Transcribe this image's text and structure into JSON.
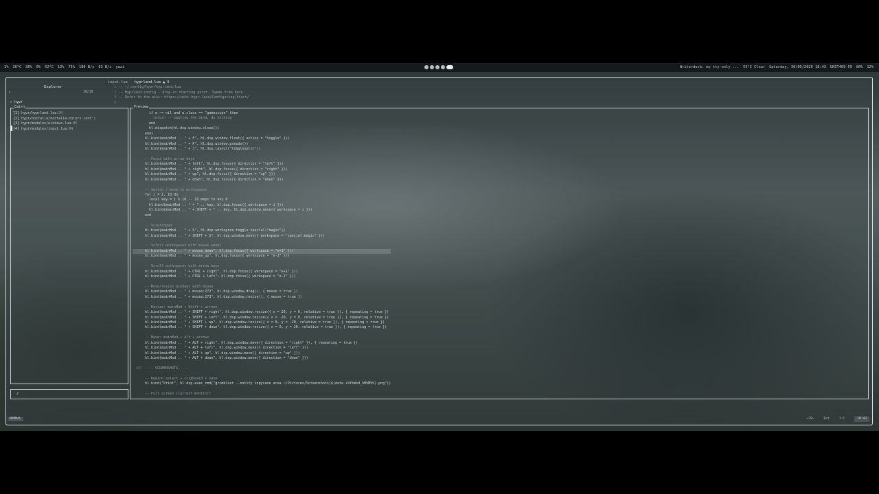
{
  "statusbar": {
    "left_items": [
      "1%",
      "36°C",
      "36%",
      "0%",
      "52°C",
      "12%",
      "75%",
      "100 B/s",
      "63 B/s",
      "yazi"
    ],
    "right_items": [
      "Writerdeck: my tty-only ...",
      "55°C Clear",
      "Saturday, 30/05/2026 18:43",
      "UNIT469-59",
      "80%",
      "12%"
    ]
  },
  "explorer": {
    "title": "Explorer",
    "count": "10/10",
    "cwd": "hypr",
    "group_label": "Cairn",
    "files": [
      {
        "index": "[1]",
        "path": "hypr/hyprland.lua",
        "suffix": ":34"
      },
      {
        "index": "[2]",
        "path": "hypr/noctalia/noctalia-colors.conf",
        "suffix": ":1"
      },
      {
        "index": "[3]",
        "path": "hypr/modules/windows.lua",
        "suffix": ":95"
      },
      {
        "index": "[4]",
        "path": "hypr/modules/input.lua",
        "suffix": ":84"
      }
    ],
    "prompt": "/"
  },
  "tabs": [
    {
      "label": "input.lua",
      "active": false
    },
    {
      "label": "hyprland.lua  ▲ 5",
      "active": true
    }
  ],
  "header_code": [
    {
      "n": "1",
      "t": "-- ~/.config/hypr/hyprland.lua"
    },
    {
      "n": "2",
      "t": "-- Hyprland config - drop-in starting point. Tweak from here."
    },
    {
      "n": "3",
      "t": "-- Refer to the wiki: https://wiki.hypr.land/Configuring/Start/"
    },
    {
      "n": "4",
      "t": ""
    }
  ],
  "preview": {
    "title": "Preview",
    "lines": [
      {
        "n": "",
        "t": "  if w ~= nil and w.class == \"gamescope\" then",
        "c": false
      },
      {
        "n": "",
        "t": "    return -- swallow the bind, do nothing",
        "c": true
      },
      {
        "n": "",
        "t": "  end",
        "c": false
      },
      {
        "n": "",
        "t": "  hl.dispatch(hl.dsp.window.close())",
        "c": false
      },
      {
        "n": "",
        "t": "end)",
        "c": false
      },
      {
        "n": "",
        "t": "hl.bind(mainMod .. \" + F\", hl.dsp.window.float({ action = \"toggle\" }))",
        "c": false
      },
      {
        "n": "",
        "t": "hl.bind(mainMod .. \" + P\", hl.dsp.window.pseudo())",
        "c": false
      },
      {
        "n": "",
        "t": "hl.bind(mainMod .. \" + J\", hl.dsp.layout(\"togglesplit\"))",
        "c": false
      },
      {
        "n": "",
        "t": "",
        "c": false
      },
      {
        "n": "",
        "t": "-- Focus with arrow keys",
        "c": true
      },
      {
        "n": "",
        "t": "hl.bind(mainMod .. \" + left\", hl.dsp.focus({ direction = \"left\" }))",
        "c": false
      },
      {
        "n": "",
        "t": "hl.bind(mainMod .. \" + right\", hl.dsp.focus({ direction = \"right\" }))",
        "c": false
      },
      {
        "n": "",
        "t": "hl.bind(mainMod .. \" + up\", hl.dsp.focus({ direction = \"up\" }))",
        "c": false
      },
      {
        "n": "",
        "t": "hl.bind(mainMod .. \" + down\", hl.dsp.focus({ direction = \"down\" }))",
        "c": false
      },
      {
        "n": "",
        "t": "",
        "c": false
      },
      {
        "n": "",
        "t": "-- Switch / move to workspaces",
        "c": true
      },
      {
        "n": "",
        "t": "for i = 1, 10 do",
        "c": false
      },
      {
        "n": "",
        "t": "  local key = i % 10 -- 10 maps to key 0",
        "c": false
      },
      {
        "n": "",
        "t": "  hl.bind(mainMod .. \" + \" .. key, hl.dsp.focus({ workspace = i }))",
        "c": false
      },
      {
        "n": "",
        "t": "  hl.bind(mainMod .. \" + SHIFT + \" .. key, hl.dsp.window.move({ workspace = i }))",
        "c": false
      },
      {
        "n": "",
        "t": "end",
        "c": false
      },
      {
        "n": "",
        "t": "",
        "c": false
      },
      {
        "n": "",
        "t": "-- Scratchpad",
        "c": true
      },
      {
        "n": "",
        "t": "hl.bind(mainMod .. \" + S\", hl.dsp.workspace.toggle_special(\"magic\"))",
        "c": false
      },
      {
        "n": "",
        "t": "hl.bind(mainMod .. \" + SHIFT + S\", hl.dsp.window.move({ workspace = \"special:magic\" }))",
        "c": false
      },
      {
        "n": "",
        "t": "",
        "c": false
      },
      {
        "n": "",
        "t": "-- Scroll workspaces with mouse wheel",
        "c": true
      },
      {
        "n": "84",
        "t": "hl.bind(mainMod .. \" + mouse_down\", hl.dsp.focus({ workspace = \"e+1\" }))",
        "c": false,
        "cur": true
      },
      {
        "n": "",
        "t": "hl.bind(mainMod .. \" + mouse_up\", hl.dsp.focus({ workspace = \"e-1\" }))",
        "c": false
      },
      {
        "n": "",
        "t": "",
        "c": false
      },
      {
        "n": "",
        "t": "-- Scroll workspaces with arrow keys",
        "c": true
      },
      {
        "n": "",
        "t": "hl.bind(mainMod .. \" + CTRL + right\", hl.dsp.focus({ workspace = \"e+1\" }))",
        "c": false
      },
      {
        "n": "",
        "t": "hl.bind(mainMod .. \" + CTRL + left\", hl.dsp.focus({ workspace = \"e-1\" }))",
        "c": false
      },
      {
        "n": "",
        "t": "",
        "c": false
      },
      {
        "n": "",
        "t": "-- Move/resize windows with mouse",
        "c": true
      },
      {
        "n": "",
        "t": "hl.bind(mainMod .. \" + mouse:272\", hl.dsp.window.drag(), { mouse = true })",
        "c": false
      },
      {
        "n": "",
        "t": "hl.bind(mainMod .. \" + mouse:273\", hl.dsp.window.resize(), { mouse = true })",
        "c": false
      },
      {
        "n": "",
        "t": "",
        "c": false
      },
      {
        "n": "",
        "t": "-- Resize: mainMod + Shift + arrows",
        "c": true
      },
      {
        "n": "",
        "t": "hl.bind(mainMod .. \" + SHIFT + right\", hl.dsp.window.resize({ x = 20, y = 0, relative = true }), { repeating = true })",
        "c": false
      },
      {
        "n": "",
        "t": "hl.bind(mainMod .. \" + SHIFT + left\", hl.dsp.window.resize({ x = -20, y = 0, relative = true }), { repeating = true })",
        "c": false
      },
      {
        "n": "",
        "t": "hl.bind(mainMod .. \" + SHIFT + up\", hl.dsp.window.resize({ x = 0, y = -20, relative = true }), { repeating = true })",
        "c": false
      },
      {
        "n": "",
        "t": "hl.bind(mainMod .. \" + SHIFT + down\", hl.dsp.window.resize({ x = 0, y = 20, relative = true }), { repeating = true })",
        "c": false
      },
      {
        "n": "",
        "t": "",
        "c": false
      },
      {
        "n": "",
        "t": "-- Move: mainMod + Alt + arrows",
        "c": true
      },
      {
        "n": "",
        "t": "hl.bind(mainMod .. \" + ALT + right\", hl.dsp.window.move({ direction = \"right\" }), { repeating = true })",
        "c": false
      },
      {
        "n": "",
        "t": "hl.bind(mainMod .. \" + ALT + left\", hl.dsp.window.move({ direction = \"left\" }))",
        "c": false
      },
      {
        "n": "",
        "t": "hl.bind(mainMod .. \" + ALT + up\", hl.dsp.window.move({ direction = \"up\" }))",
        "c": false
      },
      {
        "n": "",
        "t": "hl.bind(mainMod .. \" + ALT + down\", hl.dsp.window.move({ direction = \"down\" }))",
        "c": false
      },
      {
        "n": "",
        "t": "",
        "c": false
      },
      {
        "n": "107",
        "t": "---- SCREENSHOTS ----",
        "c": true
      },
      {
        "n": "",
        "t": "",
        "c": false
      },
      {
        "n": "",
        "t": "-- Region select → clipboard + save",
        "c": true
      },
      {
        "n": "",
        "t": "hl.bind(\"Print\", hl.dsp.exec_cmd(\"grimblast --notify copysave area ~/Pictures/Screenshots/$(date +%Y%m%d_%H%M%S).png\"))",
        "c": false
      },
      {
        "n": "",
        "t": "",
        "c": false
      },
      {
        "n": "",
        "t": "-- Full screen (current monitor)",
        "c": true
      }
    ]
  },
  "statusline": {
    "mode": "NORMAL",
    "right": [
      "<20>",
      "Bot",
      "1:1",
      "18:43"
    ]
  }
}
